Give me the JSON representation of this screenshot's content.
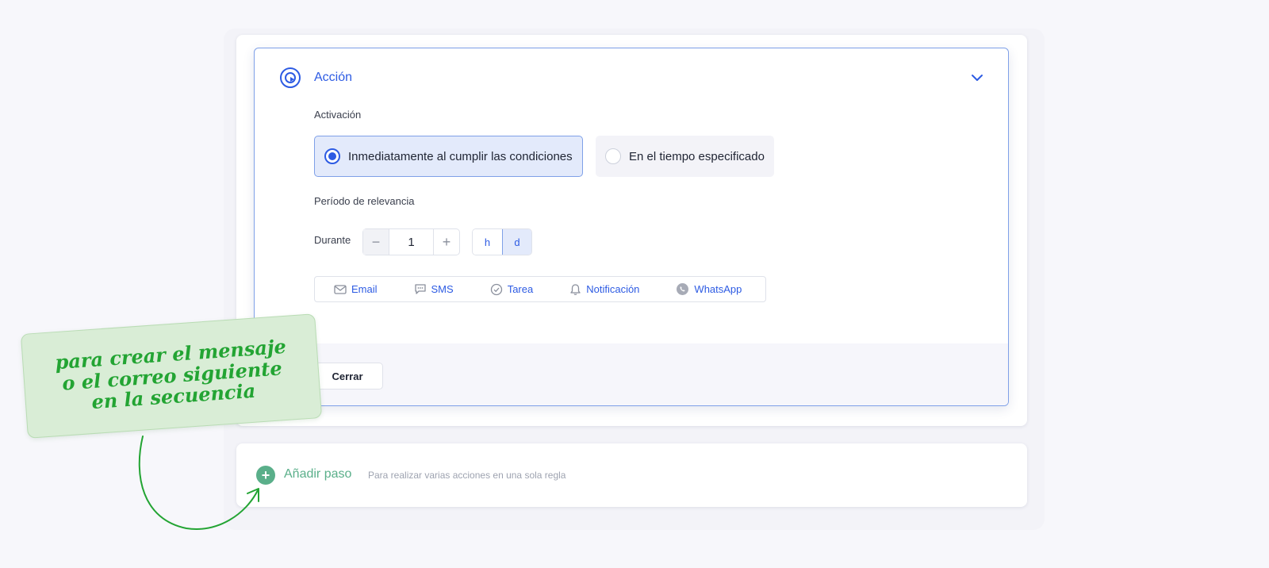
{
  "action": {
    "title": "Acción",
    "activation": {
      "label": "Activación",
      "options": [
        {
          "label": "Inmediatamente al cumplir las condiciones",
          "selected": true
        },
        {
          "label": "En el tiempo especificado",
          "selected": false
        }
      ]
    },
    "relevance": {
      "label": "Período de relevancia",
      "during_label": "Durante",
      "value": "1",
      "minus": "−",
      "plus": "+",
      "units": [
        {
          "label": "h",
          "active": false
        },
        {
          "label": "d",
          "active": true
        }
      ]
    },
    "channels": [
      {
        "label": "Email",
        "icon": "mail-icon"
      },
      {
        "label": "SMS",
        "icon": "chat-icon"
      },
      {
        "label": "Tarea",
        "icon": "check-circle-icon"
      },
      {
        "label": "Notificación",
        "icon": "bell-icon"
      },
      {
        "label": "WhatsApp",
        "icon": "whatsapp-icon"
      }
    ],
    "close_label": "Cerrar"
  },
  "add_step": {
    "title": "Añadir paso",
    "description": "Para realizar varias acciones en una sola regla"
  },
  "annotation": {
    "lines": [
      "para crear el mensaje",
      "o el correo siguiente",
      "en la secuencia"
    ]
  },
  "colors": {
    "accent": "#2d5be3",
    "green": "#5aaf8a",
    "note_bg": "#d9edd6",
    "note_text": "#23a433"
  }
}
